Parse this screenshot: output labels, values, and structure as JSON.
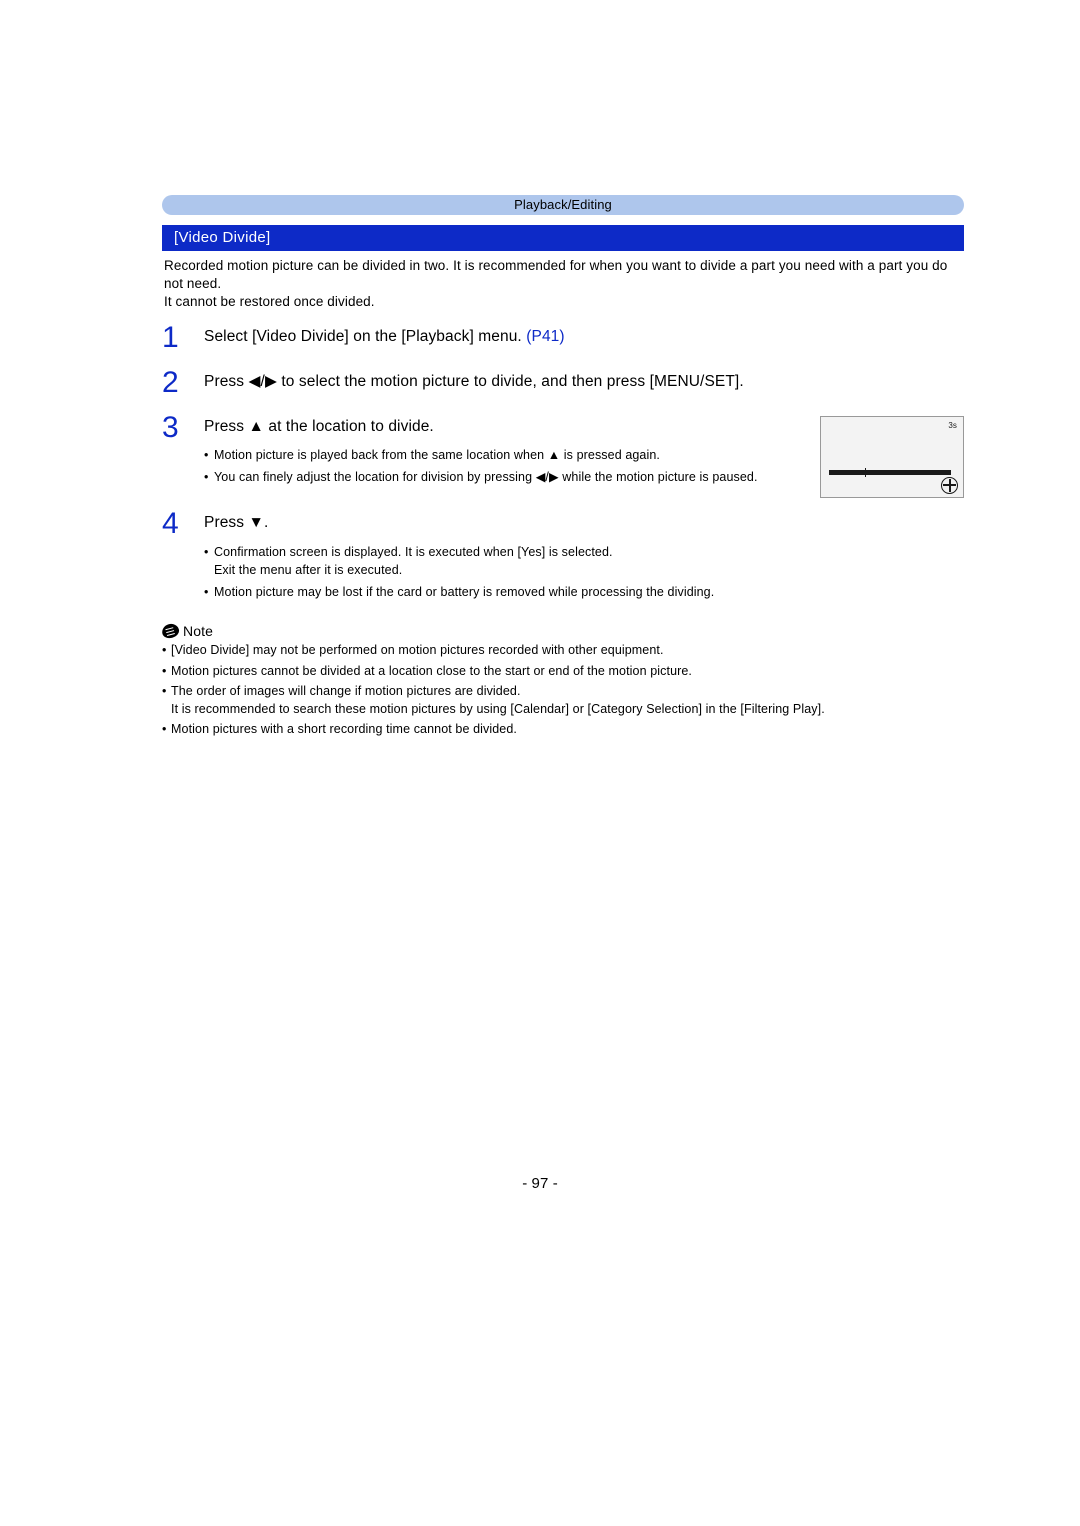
{
  "breadcrumb": "Playback/Editing",
  "section_title": "[Video Divide]",
  "intro_lines": [
    "Recorded motion picture can be divided in two. It is recommended for when you want to divide a part you need with a part you do not need.",
    "It cannot be restored once divided."
  ],
  "steps": [
    {
      "num": "1",
      "text": "Select [Video Divide] on the [Playback] menu. ",
      "ref": "(P41)"
    },
    {
      "num": "2",
      "text": "Press ◀/▶ to select the motion picture to divide, and then press [MENU/SET]."
    },
    {
      "num": "3",
      "text": "Press ▲ at the location to divide.",
      "bullets": [
        "Motion picture is played back from the same location when ▲ is pressed again.",
        "You can finely adjust the location for division by pressing ◀/▶ while the motion picture is paused."
      ],
      "preview": {
        "time": "3s"
      }
    },
    {
      "num": "4",
      "text": "Press ▼.",
      "bullets": [
        "Confirmation screen is displayed. It is executed when [Yes] is selected.\nExit the menu after it is executed.",
        "Motion picture may be lost if the card or battery is removed while processing the dividing."
      ]
    }
  ],
  "note_label": "Note",
  "note_bullets": [
    "[Video Divide] may not be performed on motion pictures recorded with other equipment.",
    "Motion pictures cannot be divided at a location close to the start or end of the motion picture.",
    "The order of images will change if motion pictures are divided.\nIt is recommended to search these motion pictures by using [Calendar] or [Category Selection] in the [Filtering Play].",
    "Motion pictures with a short recording time cannot be divided."
  ],
  "page_number": "- 97 -"
}
